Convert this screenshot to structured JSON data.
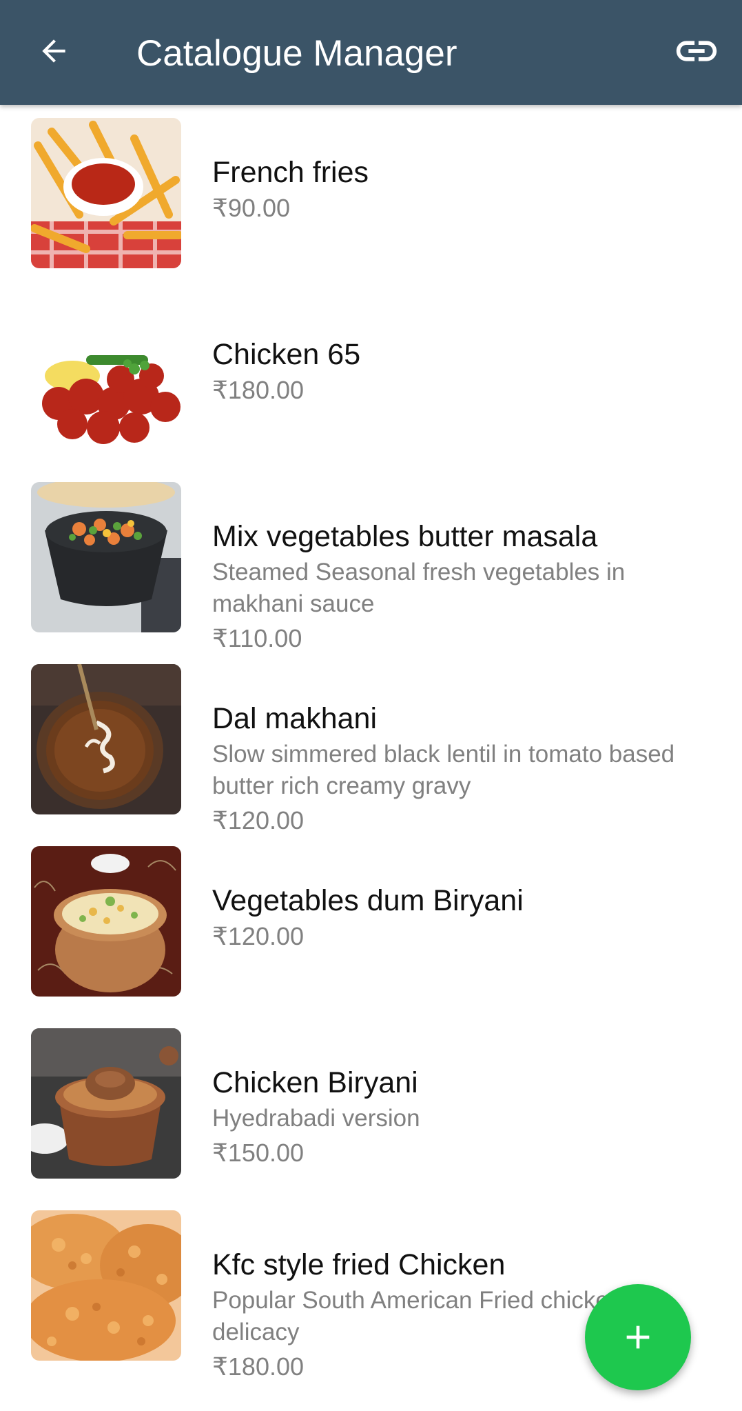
{
  "colors": {
    "app_bar": "#3b5467",
    "fab": "#1ec84e",
    "title_text": "#ffffff",
    "item_name": "#111111",
    "item_secondary": "#808080"
  },
  "header": {
    "back_icon": "arrow-left-icon",
    "title": "Catalogue Manager",
    "link_icon": "link-icon"
  },
  "items": [
    {
      "name": "French fries",
      "description": "",
      "price": "₹90.00"
    },
    {
      "name": "Chicken 65",
      "description": "",
      "price": "₹180.00"
    },
    {
      "name": "Mix vegetables butter masala",
      "description": "Steamed Seasonal fresh vegetables in makhani sauce",
      "price": "₹110.00"
    },
    {
      "name": "Dal makhani",
      "description": "Slow simmered black lentil in tomato based butter rich creamy gravy",
      "price": "₹120.00"
    },
    {
      "name": "Vegetables dum Biryani",
      "description": "",
      "price": "₹120.00"
    },
    {
      "name": "Chicken Biryani",
      "description": "Hyedrabadi version",
      "price": "₹150.00"
    },
    {
      "name": "Kfc style fried Chicken",
      "description": "Popular South American Fried chicken delicacy",
      "price": "₹180.00"
    }
  ],
  "fab": {
    "icon": "plus-icon"
  }
}
